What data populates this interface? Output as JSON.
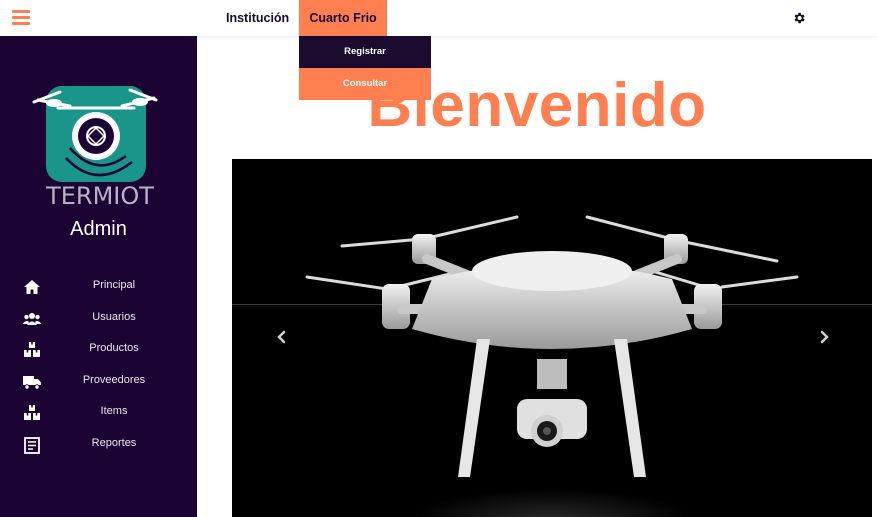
{
  "topbar": {
    "menu_icon": "hamburger-icon",
    "nav": [
      {
        "label": "Institución"
      },
      {
        "label": "Cuarto Frio"
      }
    ],
    "settings_icon": "gear-icon",
    "dropdown": [
      {
        "label": "Registrar"
      },
      {
        "label": "Consultar"
      }
    ]
  },
  "sidebar": {
    "logo_text": "TERMIOT",
    "user": "Admin",
    "items": [
      {
        "label": "Principal",
        "icon": "home-icon"
      },
      {
        "label": "Usuarios",
        "icon": "users-icon"
      },
      {
        "label": "Productos",
        "icon": "boxes-icon"
      },
      {
        "label": "Proveedores",
        "icon": "truck-icon"
      },
      {
        "label": "Items",
        "icon": "boxes-icon"
      },
      {
        "label": "Reportes",
        "icon": "report-icon"
      }
    ]
  },
  "main": {
    "heading": "Bienvenido",
    "carousel": {
      "slide": "drone-image",
      "prev_icon": "chevron-left-icon",
      "next_icon": "chevron-right-icon"
    }
  },
  "colors": {
    "accent": "#ff7f50",
    "sidebar": "#1b0433",
    "dark_text": "#1b0b2e"
  }
}
